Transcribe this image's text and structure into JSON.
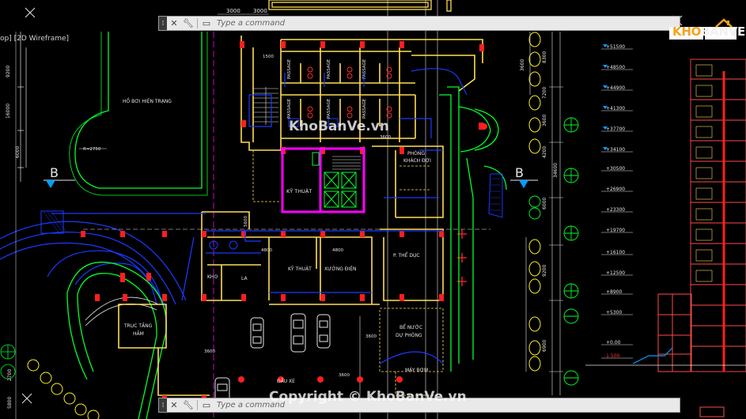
{
  "app": {
    "viewport_label": "op] [2D Wireframe]",
    "command_placeholder": "Type a command",
    "command_icons": [
      "close-icon",
      "wrench-icon",
      "command-history-icon"
    ]
  },
  "watermarks": {
    "center": "KhoBanVe.vn",
    "bottom": "Copyright © KhoBanVe.vn",
    "logo_prefix": "KHO",
    "logo_suffix": "BANVE"
  },
  "drawing": {
    "room_labels": [
      "HỒ BƠI HIỆN TRẠNG",
      "KỸ THUẬT",
      "KHO",
      "LA",
      "KỸ THUẬT",
      "XƯỞNG ĐIỆN",
      "P. THỂ DỤC",
      "PHÒNG",
      "KHÁCH ĐỢI",
      "TRỤC TẦNG",
      "HẦM",
      "BỂ NƯỚC",
      "DỰ PHÒNG",
      "MÁY BƠM",
      "ĐẦU XE",
      "PASSAGE"
    ],
    "dimensions": [
      "3000",
      "3000",
      "1500",
      "3600",
      "2750",
      "6000",
      "9200",
      "8300",
      "7200",
      "3600",
      "4200",
      "6000",
      "9200",
      "6900",
      "4800",
      "4800",
      "3600",
      "3600",
      "2700",
      "5800"
    ],
    "section_marks": [
      "B",
      "B"
    ],
    "radius_label": "R=2750",
    "elevations": [
      "+51500",
      "+48500",
      "+44900",
      "+41300",
      "+37700",
      "+34100",
      "+30500",
      "+26900",
      "+23300",
      "+19700",
      "+16100",
      "+12500",
      "+8900",
      "+5300",
      "+0.00",
      "-1.500"
    ],
    "colors": {
      "background": "#000000",
      "wall": "#ffdd55",
      "column": "#ff1f1f",
      "dimension": "#e0e0e0",
      "grid": "#0000ff",
      "landscape": "#00ff2a",
      "highlight": "#ff00ff",
      "axis": "#ff00ff",
      "logo_accent": "#f7a21d"
    }
  }
}
